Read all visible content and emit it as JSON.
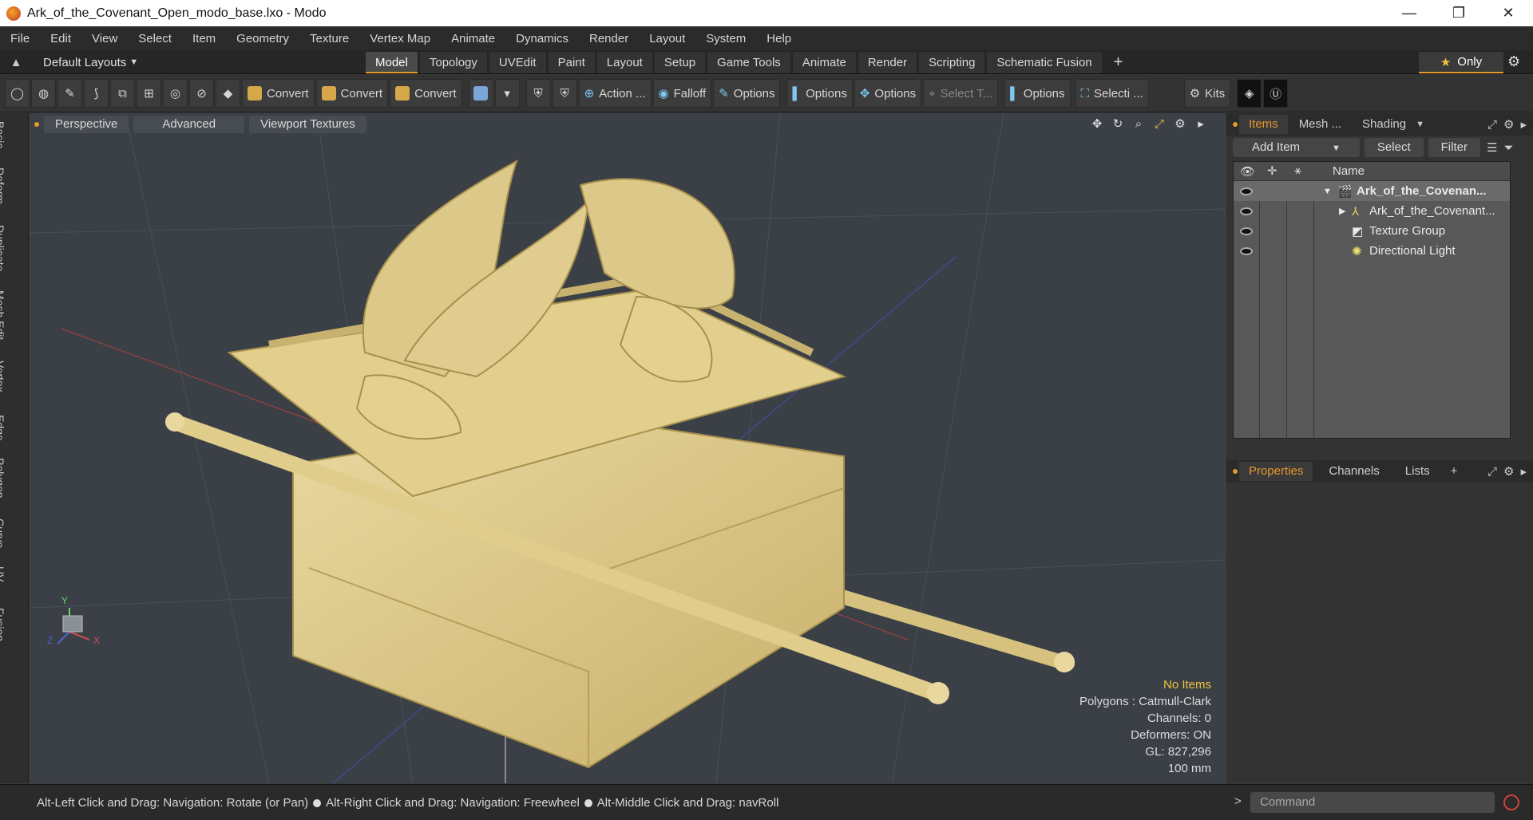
{
  "window": {
    "title": "Ark_of_the_Covenant_Open_modo_base.lxo - Modo",
    "minimize": "—",
    "maximize": "❐",
    "close": "✕"
  },
  "menu": [
    "File",
    "Edit",
    "View",
    "Select",
    "Item",
    "Geometry",
    "Texture",
    "Vertex Map",
    "Animate",
    "Dynamics",
    "Render",
    "Layout",
    "System",
    "Help"
  ],
  "layout_selector": "Default Layouts",
  "workspace_tabs": [
    "Model",
    "Topology",
    "UVEdit",
    "Paint",
    "Layout",
    "Setup",
    "Game Tools",
    "Animate",
    "Render",
    "Scripting",
    "Schematic Fusion"
  ],
  "active_tab": "Model",
  "only_button": "Only",
  "toolbar": {
    "convert1": "Convert",
    "convert2": "Convert",
    "convert3": "Convert",
    "action": "Action ...",
    "falloff": "Falloff",
    "options1": "Options",
    "options2": "Options",
    "options3": "Options",
    "select_t": "Select T...",
    "options4": "Options",
    "selecti": "Selecti ...",
    "kits": "Kits"
  },
  "left_strip": [
    "Basic",
    "Deform",
    "Duplicate",
    "Mesh Edit",
    "Vertex",
    "Edge",
    "Polygon",
    "Curve",
    "UV",
    "Fusion"
  ],
  "viewport": {
    "view": "Perspective",
    "mode": "Advanced",
    "textures": "Viewport Textures",
    "info": {
      "no_items": "No Items",
      "polygons": "Polygons : Catmull-Clark",
      "channels": "Channels: 0",
      "deformers": "Deformers: ON",
      "gl": "GL: 827,296",
      "scale": "100 mm"
    },
    "axis_y": "Y",
    "axis_x": "X",
    "axis_z": "Z"
  },
  "items_panel": {
    "tabs": [
      "Items",
      "Mesh ...",
      "Shading"
    ],
    "add_item": "Add Item",
    "select": "Select",
    "filter": "Filter",
    "name_col": "Name",
    "rows": [
      {
        "label": "Ark_of_the_Covenan...",
        "bold": true
      },
      {
        "label": "Ark_of_the_Covenant..."
      },
      {
        "label": "Texture Group"
      },
      {
        "label": "Directional Light"
      }
    ]
  },
  "props_panel": {
    "tabs": [
      "Properties",
      "Channels",
      "Lists"
    ],
    "add": "+"
  },
  "status": {
    "left": "Alt-Left Click and Drag: Navigation: Rotate (or Pan)",
    "mid": "Alt-Right Click and Drag: Navigation: Freewheel",
    "right": "Alt-Middle Click and Drag: navRoll",
    "command_placeholder": "Command"
  }
}
